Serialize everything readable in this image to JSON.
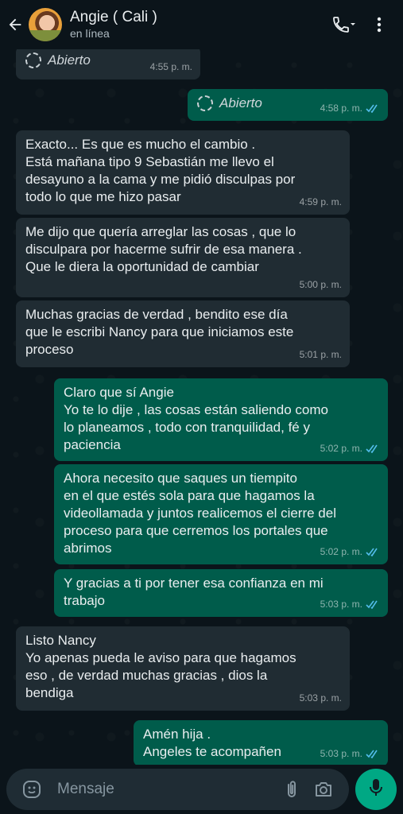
{
  "header": {
    "contact_name": "Angie ( Cali )",
    "status": "en línea"
  },
  "input": {
    "placeholder": "Mensaje"
  },
  "messages": [
    {
      "side": "in",
      "kind": "status",
      "lines": [
        "Abierto"
      ],
      "time": "4:55 p. m."
    },
    {
      "side": "out",
      "kind": "status",
      "lines": [
        "Abierto"
      ],
      "time": "4:58 p. m.",
      "read": true
    },
    {
      "side": "in",
      "lines": [
        "Exacto... Es que es mucho el cambio .",
        "Está mañana tipo 9 Sebastián me llevo el",
        "desayuno a la cama y me pidió disculpas por",
        "todo lo que me hizo pasar"
      ],
      "time": "4:59 p. m."
    },
    {
      "side": "in",
      "lines": [
        "Me dijo que quería arreglar las cosas , que lo",
        "disculpara por hacerme sufrir de esa manera .",
        "Que le diera la oportunidad de cambiar"
      ],
      "time": "5:00 p. m."
    },
    {
      "side": "in",
      "lines": [
        "Muchas gracias de verdad , bendito ese día",
        "que le escribi Nancy para que iniciamos este",
        "proceso"
      ],
      "time": "5:01 p. m."
    },
    {
      "side": "out",
      "lines": [
        "Claro que sí Angie",
        "Yo te lo dije , las cosas están saliendo como",
        "lo planeamos , todo con tranquilidad, fé y",
        "paciencia"
      ],
      "time": "5:02 p. m.",
      "read": true
    },
    {
      "side": "out",
      "lines": [
        "Ahora necesito que saques un tiempito",
        "en el que estés sola para que hagamos la",
        "videollamada y juntos realicemos el cierre del",
        "proceso para que cerremos los portales que",
        "abrimos"
      ],
      "time": "5:02 p. m.",
      "read": true
    },
    {
      "side": "out",
      "lines": [
        "Y gracias a ti por tener esa confianza en mi",
        "trabajo"
      ],
      "time": "5:03 p. m.",
      "read": true
    },
    {
      "side": "in",
      "lines": [
        "Listo Nancy",
        "Yo apenas pueda le aviso para que hagamos",
        "eso , de verdad muchas gracias , dios la",
        "bendiga"
      ],
      "time": "5:03 p. m."
    },
    {
      "side": "out",
      "lines": [
        "Amén hija .",
        "Angeles te acompañen"
      ],
      "time": "5:03 p. m.",
      "read": true
    }
  ],
  "colors": {
    "background": "#0b141a",
    "incoming_bubble": "#202c33",
    "outgoing_bubble": "#005c4b",
    "read_ticks": "#53bdeb",
    "mic_button": "#00a884"
  },
  "icons": [
    "back-arrow-icon",
    "voice-call-icon",
    "more-options-icon",
    "emoji-icon",
    "attach-icon",
    "camera-icon",
    "mic-icon",
    "status-ring-icon",
    "double-check-icon"
  ]
}
